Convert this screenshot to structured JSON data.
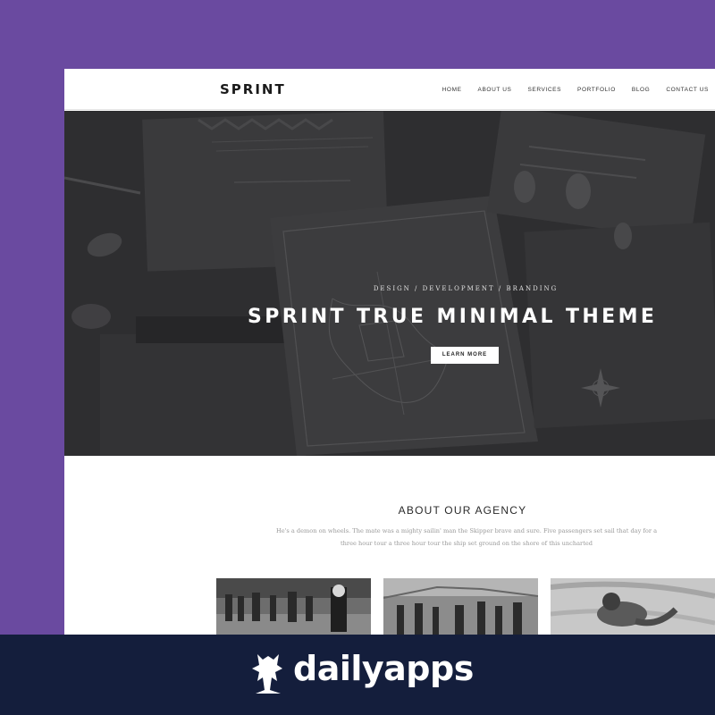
{
  "site": {
    "logo": "SPRINT",
    "nav": [
      "HOME",
      "ABOUT US",
      "SERVICES",
      "PORTFOLIO",
      "BLOG",
      "CONTACT US"
    ]
  },
  "hero": {
    "kicker": "DESIGN / DEVELOPMENT / BRANDING",
    "title": "SPRINT TRUE MINIMAL THEME",
    "button_label": "LEARN MORE"
  },
  "about": {
    "title": "ABOUT OUR AGENCY",
    "text": "He's a demon on wheels. The mate was a mighty sailin' man the Skipper brave and sure. Five passengers set sail that day for a three hour tour a three hour tour the ship set ground on the shore of this uncharted"
  },
  "branding": {
    "name": "dailyapps"
  },
  "colors": {
    "background": "#6a4aa0",
    "brand_bar": "#141e3c",
    "hero_overlay": "#2f2f31"
  }
}
